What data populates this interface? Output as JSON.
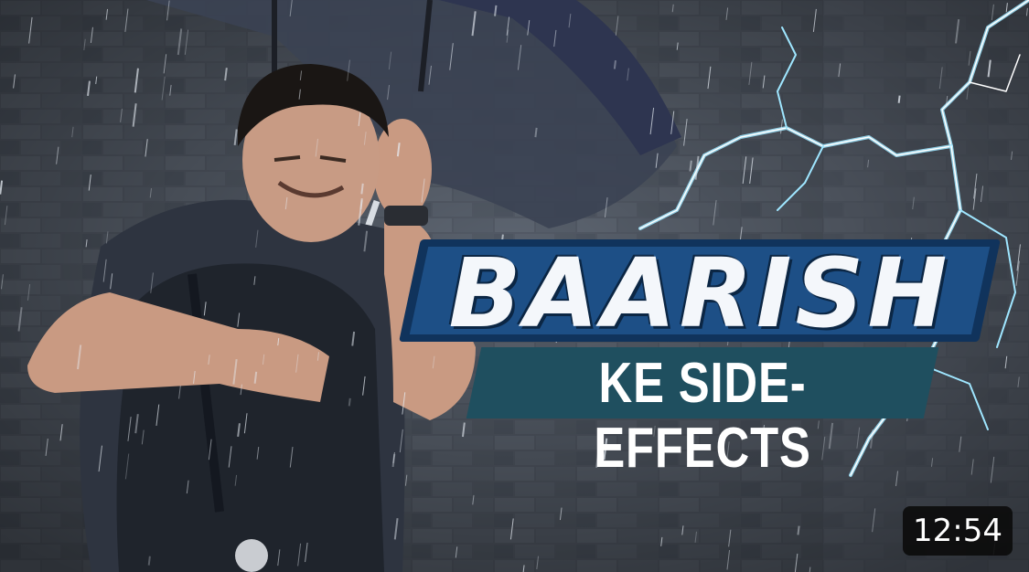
{
  "video": {
    "title_main": "BAARISH",
    "title_sub": "KE SIDE-EFFECTS",
    "duration": "12:54",
    "colors": {
      "title_fill": "#f4f7fb",
      "title_outline": "#10335c",
      "sub_bg": "#1f4f5f",
      "lightning": "#9fe6ff"
    }
  }
}
